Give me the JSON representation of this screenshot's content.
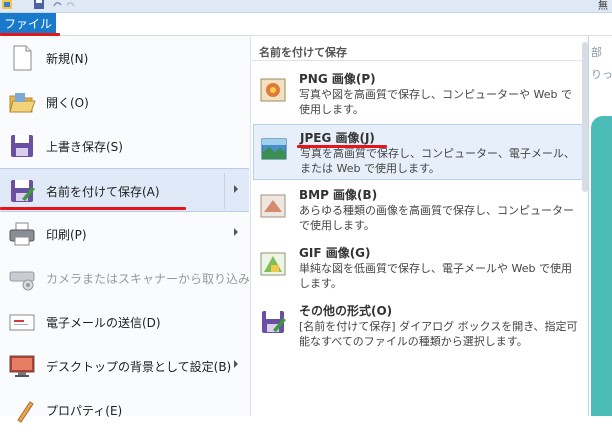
{
  "title_bar": {
    "partial_text": "無"
  },
  "ribbon": {
    "file_tab": "ファイル"
  },
  "menu": {
    "items": [
      {
        "label": "新規(N)",
        "icon": "new-document-icon"
      },
      {
        "label": "開く(O)",
        "icon": "open-folder-icon"
      },
      {
        "label": "上書き保存(S)",
        "icon": "save-floppy-icon"
      },
      {
        "label": "名前を付けて保存(A)",
        "icon": "save-as-icon",
        "selected": true
      },
      {
        "label": "印刷(P)",
        "icon": "printer-icon"
      },
      {
        "label": "カメラまたはスキャナーから取り込み(M)",
        "icon": "scanner-icon",
        "disabled": true
      },
      {
        "label": "電子メールの送信(D)",
        "icon": "email-icon"
      },
      {
        "label": "デスクトップの背景として設定(B)",
        "icon": "desktop-icon"
      },
      {
        "label": "プロパティ(E)",
        "icon": "properties-icon"
      }
    ]
  },
  "submenu": {
    "header": "名前を付けて保存",
    "items": [
      {
        "title": "PNG 画像(P)",
        "desc": "写真や図を高画質で保存し、コンピューターや Web で使用します。",
        "icon": "png-image-icon"
      },
      {
        "title": "JPEG 画像(J)",
        "desc": "写真を高画質で保存し、コンピューター、電子メール、または Web で使用します。",
        "icon": "jpeg-image-icon",
        "selected": true
      },
      {
        "title": "BMP 画像(B)",
        "desc": "あらゆる種類の画像を高画質で保存し、コンピューターで使用します。",
        "icon": "bmp-image-icon"
      },
      {
        "title": "GIF 画像(G)",
        "desc": "単純な図を低画質で保存し、電子メールや Web で使用します。",
        "icon": "gif-image-icon"
      },
      {
        "title": "その他の形式(O)",
        "desc": "[名前を付けて保存] ダイアログ ボックスを開き、指定可能なすべてのファイルの種類から選択します。",
        "icon": "other-formats-icon"
      }
    ]
  },
  "background": {
    "text_1": "部",
    "text_2": "りっこ"
  },
  "colors": {
    "file_tab": "#1979ca",
    "selection": "#dfe9f7",
    "annotation": "#e8141c"
  }
}
